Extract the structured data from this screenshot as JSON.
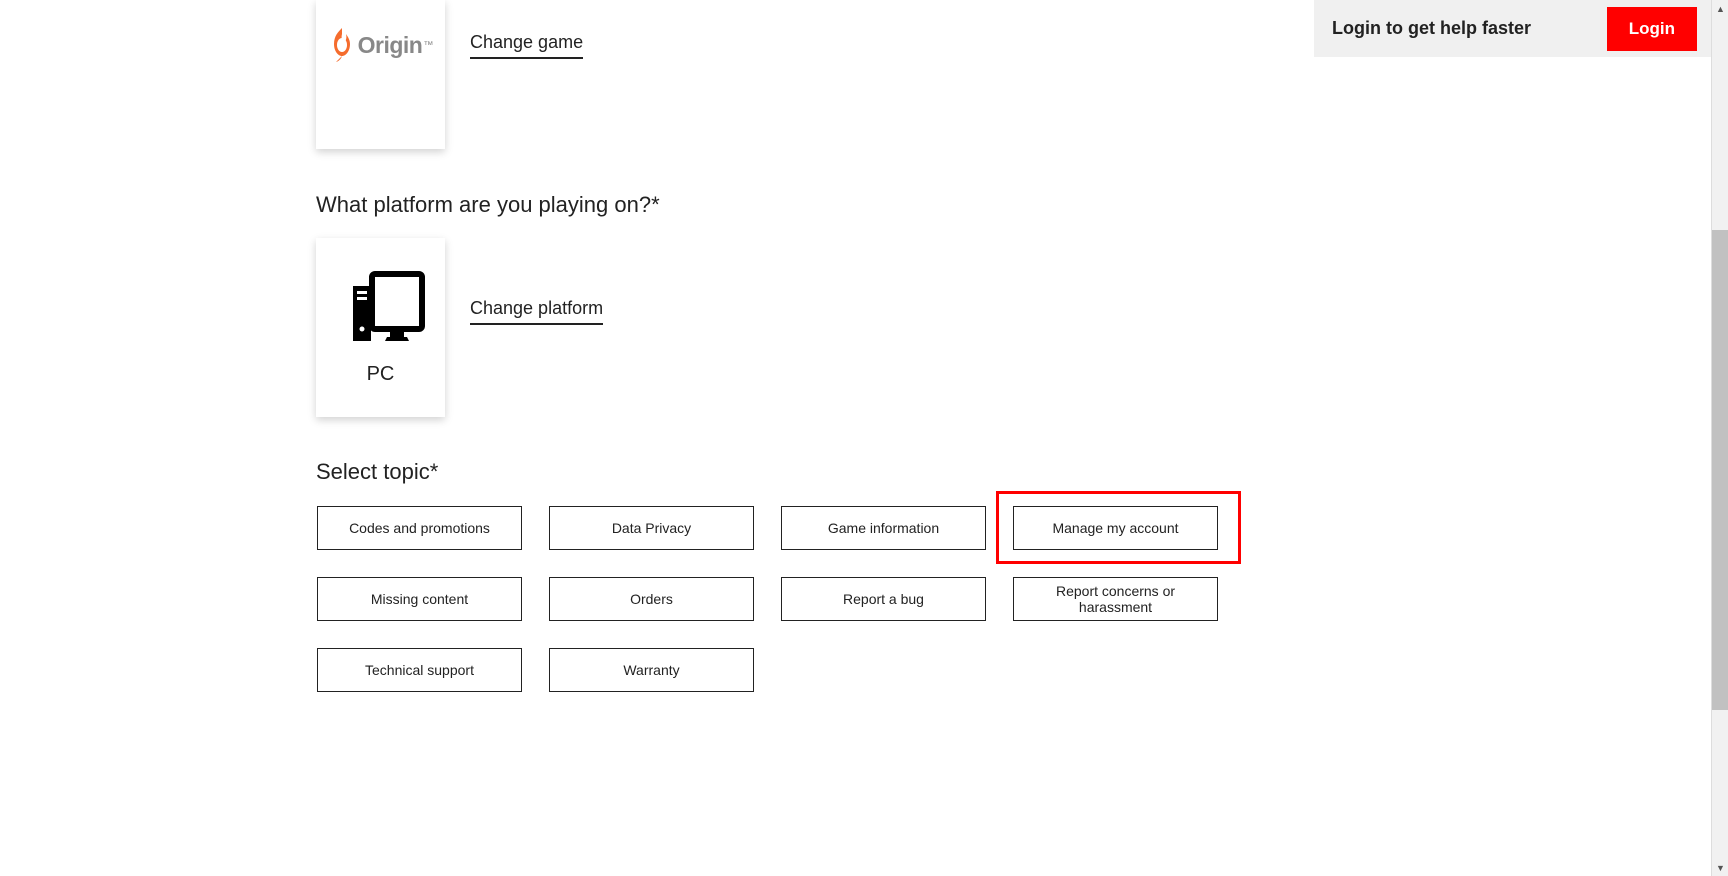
{
  "loginBar": {
    "text": "Login to get help faster",
    "button": "Login"
  },
  "game": {
    "brand": "Origin",
    "changeLink": "Change game"
  },
  "platform": {
    "heading": "What platform are you playing on?*",
    "label": "PC",
    "changeLink": "Change platform"
  },
  "topic": {
    "heading": "Select topic*",
    "items": [
      "Codes and promotions",
      "Data Privacy",
      "Game information",
      "Manage my account",
      "Missing content",
      "Orders",
      "Report a bug",
      "Report concerns or harassment",
      "Technical support",
      "Warranty"
    ]
  }
}
